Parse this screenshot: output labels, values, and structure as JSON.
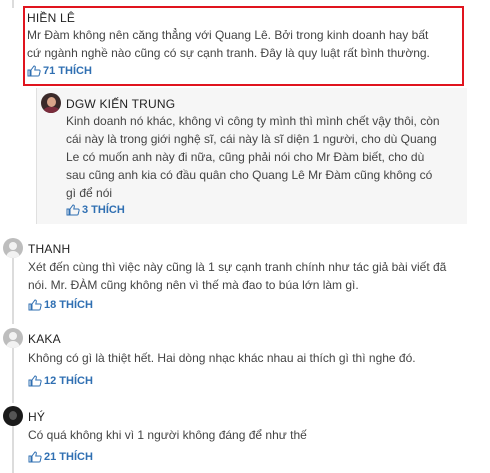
{
  "comments": [
    {
      "author": "HIỀN LÊ",
      "text": "Mr Đàm không nên căng thẳng với Quang Lê. Bởi trong kinh doanh hay bất cứ ngành nghề nào cũng có sự cạnh tranh. Đây là quy luật rất bình thường.",
      "likes": "71 THÍCH"
    },
    {
      "author": "DGW KIẾN TRUNG",
      "text": "Kinh doanh nó khác, không vì công ty mình thì mình chết vậy thôi, còn cái này là trong giới nghệ sĩ, cái này là sĩ diện 1 người, cho dù Quang Le có muốn anh này đi nữa, cũng phải nói cho Mr Đàm biết, cho dù sau cũng anh kia có đầu quân cho Quang Lê Mr Đàm cũng không có gì để nói",
      "likes": "3 THÍCH"
    },
    {
      "author": "THANH",
      "text": "Xét đến cùng thì việc này cũng là 1 sự cạnh tranh chính như tác giả bài viết đã nói. Mr. ĐÀM cũng không nên vì thế mà đao to búa lớn làm gì.",
      "likes": "18 THÍCH"
    },
    {
      "author": "KAKA",
      "text": "Không có gì là thiệt hết. Hai dòng nhạc khác nhau ai thích gì thì nghe đó.",
      "likes": "12 THÍCH"
    },
    {
      "author": "HÝ",
      "text": "Có quá không khi vì 1 người không đáng để như thế",
      "likes": "21 THÍCH"
    }
  ],
  "icons": {
    "like": "thumbs-up-icon",
    "avatar": "user-avatar-icon"
  },
  "colors": {
    "like_link": "#2f6fb2",
    "highlight_border": "#e0141e"
  }
}
